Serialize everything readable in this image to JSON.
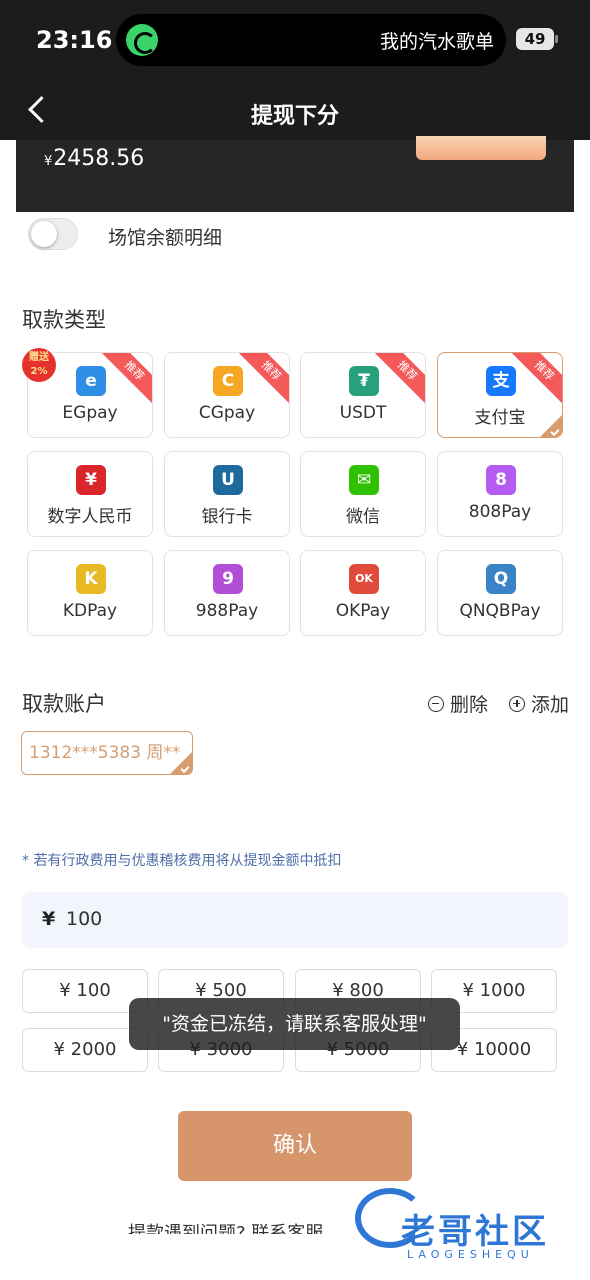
{
  "status_bar": {
    "time": "23:16",
    "now_playing": "我的汽水歌单",
    "battery": "49"
  },
  "nav": {
    "title": "提现下分"
  },
  "balance": {
    "currency": "¥",
    "amount": "2458.56"
  },
  "venue_toggle": {
    "label": "场馆余额明细",
    "on": false
  },
  "payment_section": {
    "title": "取款类型",
    "gift_badge": "赠送2%",
    "recommend_tag": "推荐",
    "methods": [
      {
        "name": "EGpay",
        "icon": "egpay-icon",
        "color": "#2e8fe6",
        "glyph": "e",
        "recommended": true,
        "selected": false
      },
      {
        "name": "CGpay",
        "icon": "cgpay-icon",
        "color": "#f5a623",
        "glyph": "C",
        "recommended": true,
        "selected": false
      },
      {
        "name": "USDT",
        "icon": "usdt-icon",
        "color": "#26a17b",
        "glyph": "₮",
        "recommended": true,
        "selected": false
      },
      {
        "name": "支付宝",
        "icon": "alipay-icon",
        "color": "#1677ff",
        "glyph": "支",
        "recommended": true,
        "selected": true
      },
      {
        "name": "数字人民币",
        "icon": "digital-rmb-icon",
        "color": "#d9262b",
        "glyph": "¥",
        "recommended": false,
        "selected": false
      },
      {
        "name": "银行卡",
        "icon": "unionpay-icon",
        "color": "#1c6b9c",
        "glyph": "U",
        "recommended": false,
        "selected": false
      },
      {
        "name": "微信",
        "icon": "wechat-icon",
        "color": "#2dc100",
        "glyph": "✉",
        "recommended": false,
        "selected": false
      },
      {
        "name": "808Pay",
        "icon": "808pay-icon",
        "color": "#b45cf0",
        "glyph": "8",
        "recommended": false,
        "selected": false
      },
      {
        "name": "KDPay",
        "icon": "kdpay-icon",
        "color": "#e8b923",
        "glyph": "K",
        "recommended": false,
        "selected": false
      },
      {
        "name": "988Pay",
        "icon": "988pay-icon",
        "color": "#b14fd6",
        "glyph": "9",
        "recommended": false,
        "selected": false
      },
      {
        "name": "OKPay",
        "icon": "okpay-icon",
        "color": "#e14b3b",
        "glyph": "OK",
        "recommended": false,
        "selected": false
      },
      {
        "name": "QNQBPay",
        "icon": "qnqbpay-icon",
        "color": "#3b83c7",
        "glyph": "Q",
        "recommended": false,
        "selected": false
      }
    ]
  },
  "account_section": {
    "title": "取款账户",
    "delete_label": "删除",
    "add_label": "添加",
    "selected_account": "1312***5383 周**"
  },
  "note": "* 若有行政费用与优惠稽核费用将从提现金额中抵扣",
  "amount": {
    "currency": "¥",
    "value": "100"
  },
  "quick_amounts": [
    "¥ 100",
    "¥ 500",
    "¥ 800",
    "¥ 1000",
    "¥ 2000",
    "¥ 3000",
    "¥ 5000",
    "¥ 10000"
  ],
  "toast": "\"资金已冻结，请联系客服处理\"",
  "confirm_label": "确认",
  "footer_text": "提款遇到问题? 联系客服",
  "watermark": {
    "text": "老哥社区",
    "sub": "LAOGESHEQU"
  },
  "colors": {
    "accent": "#d79d6f",
    "confirm_bg": "#d6956b",
    "header_bg": "#1c1c1c",
    "note": "#4e6ea8",
    "ribbon": "#f4595a"
  }
}
